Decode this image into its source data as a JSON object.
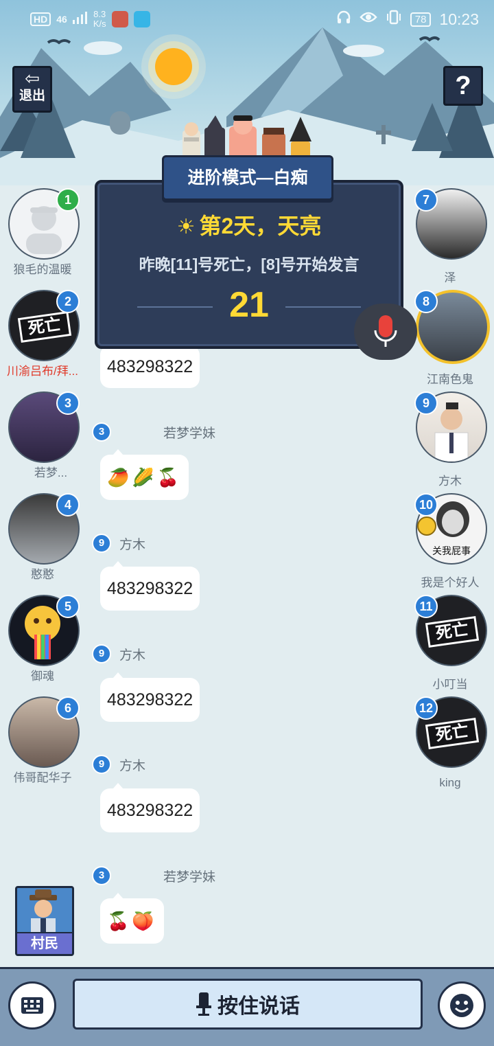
{
  "status_bar": {
    "network_badge": "HD",
    "signal": "46",
    "speed_value": "8.3",
    "speed_unit": "K/s",
    "battery": "78",
    "time": "10:23",
    "icons": [
      "headphones-icon",
      "eye-icon",
      "vibrate-icon"
    ]
  },
  "header": {
    "exit_label": "退出",
    "help_label": "?",
    "mode_title": "进阶模式—白痴"
  },
  "board": {
    "day_text": "第2天，天亮",
    "message": "昨晚[11]号死亡，[8]号开始发言",
    "countdown": "21"
  },
  "dead_label": "死亡",
  "players_left": [
    {
      "num": "1",
      "name": "狼毛的温暖",
      "dead": false
    },
    {
      "num": "2",
      "name": "川渝吕布/拜...",
      "dead": true
    },
    {
      "num": "3",
      "name": "若梦...",
      "dead": false
    },
    {
      "num": "4",
      "name": "憨憨",
      "dead": false
    },
    {
      "num": "5",
      "name": "御魂",
      "dead": false
    },
    {
      "num": "6",
      "name": "伟哥配华子",
      "dead": false
    }
  ],
  "players_right": [
    {
      "num": "7",
      "name": "泽",
      "dead": false
    },
    {
      "num": "8",
      "name": "江南色鬼",
      "dead": false
    },
    {
      "num": "9",
      "name": "方木",
      "dead": false
    },
    {
      "num": "10",
      "name": "我是个好人",
      "avatar_text": "关我屁事",
      "dead": false
    },
    {
      "num": "11",
      "name": "小叮当",
      "dead": true
    },
    {
      "num": "12",
      "name": "king",
      "dead": true
    }
  ],
  "chat": [
    {
      "text": "483298322"
    },
    {
      "num": "3",
      "name": "若梦学妹",
      "emojis": [
        "🥭",
        "🌽",
        "🍒"
      ]
    },
    {
      "num": "9",
      "name": "方木",
      "text": "483298322"
    },
    {
      "num": "9",
      "name": "方木",
      "text": "483298322"
    },
    {
      "num": "9",
      "name": "方木",
      "text": "483298322"
    },
    {
      "num": "3",
      "name": "若梦学妹",
      "emojis": [
        "🍒",
        "🍑"
      ]
    }
  ],
  "role": {
    "label": "村民"
  },
  "bottom_bar": {
    "talk_label": "按住说话"
  }
}
